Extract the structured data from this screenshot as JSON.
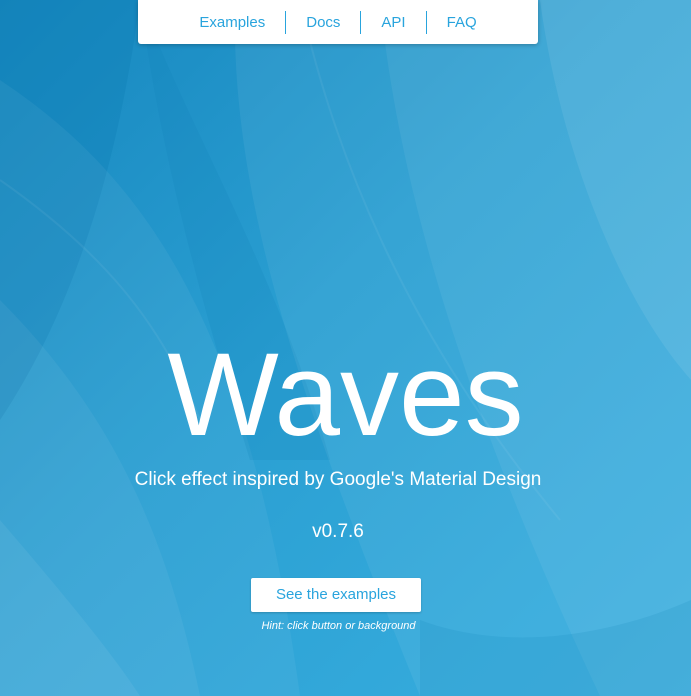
{
  "nav": {
    "items": [
      {
        "label": "Examples"
      },
      {
        "label": "Docs"
      },
      {
        "label": "API"
      },
      {
        "label": "FAQ"
      }
    ]
  },
  "hero": {
    "title": "Waves",
    "subtitle": "Click effect inspired by Google's Material Design",
    "version": "v0.7.6",
    "button_label": "See the examples",
    "hint": "Hint: click button or background"
  },
  "colors": {
    "background": "#2a9fd2",
    "accent": "#29a4dd",
    "nav_background": "#ffffff",
    "text_light": "#ffffff"
  }
}
